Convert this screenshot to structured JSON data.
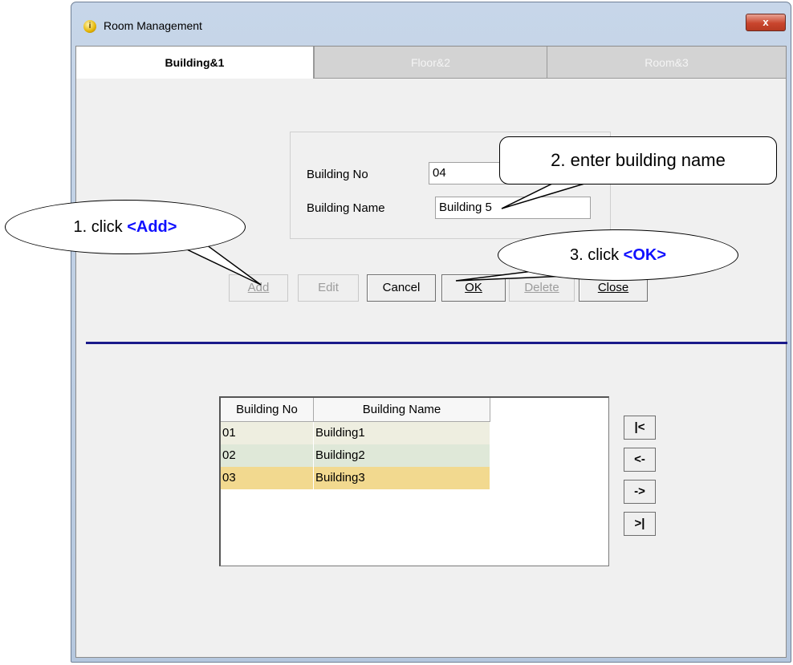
{
  "window": {
    "title": "Room Management",
    "close_glyph": "x"
  },
  "tabs": [
    {
      "label": "Building&1",
      "active": true
    },
    {
      "label": "Floor&2",
      "active": false
    },
    {
      "label": "Room&3",
      "active": false
    }
  ],
  "form": {
    "building_no_label": "Building No",
    "building_no_value": "04",
    "building_name_label": "Building Name",
    "building_name_value": "Building 5"
  },
  "buttons": {
    "add": "Add",
    "edit": "Edit",
    "cancel": "Cancel",
    "ok": "OK",
    "delete": "Delete",
    "close": "Close"
  },
  "grid": {
    "columns": [
      "Building No",
      "Building Name"
    ],
    "rows": [
      {
        "no": "01",
        "name": "Building1"
      },
      {
        "no": "02",
        "name": "Building2"
      },
      {
        "no": "03",
        "name": "Building3"
      }
    ]
  },
  "nav": {
    "first": "|<",
    "prev": "<-",
    "next": "->",
    "last": ">|"
  },
  "callouts": {
    "c1_prefix": "1. click ",
    "c1_highlight": "<Add>",
    "c2": "2. enter building name",
    "c3_prefix": "3. click ",
    "c3_highlight": "<OK>"
  },
  "colors": {
    "row_odd": "#eeeee0",
    "row_even": "#dfe8d8",
    "row_selected": "#f2d98f",
    "highlight": "#1010ff",
    "separator": "#1a1a8a"
  },
  "icons": {
    "app": "room-management-app-icon"
  }
}
